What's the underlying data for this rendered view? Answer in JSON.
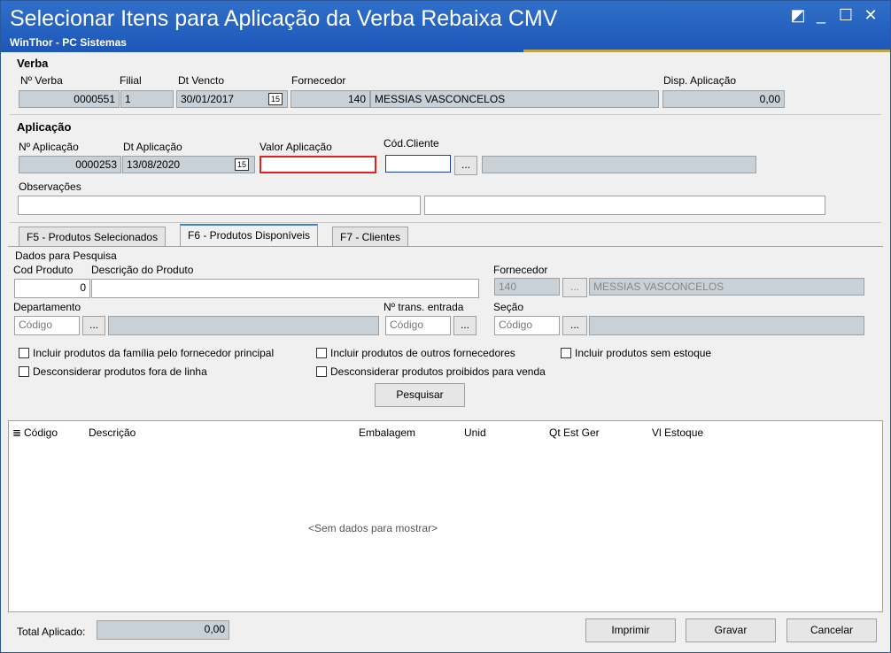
{
  "window": {
    "title": "Selecionar Itens para Aplicação da Verba Rebaixa CMV",
    "subtitle": "WinThor - PC Sistemas",
    "controls": {
      "restore": "◩",
      "minimize": "_",
      "maximize": "☐",
      "close": "✕"
    }
  },
  "verba": {
    "section": "Verba",
    "labels": {
      "numero": "Nº Verba",
      "filial": "Filial",
      "dt_vencto": "Dt Vencto",
      "fornecedor": "Fornecedor",
      "disp": "Disp. Aplicação"
    },
    "values": {
      "numero": "0000551",
      "filial": "1",
      "dt_vencto": "30/01/2017",
      "fornecedor_cod": "140",
      "fornecedor_nome": "MESSIAS VASCONCELOS",
      "disp": "0,00"
    }
  },
  "aplicacao": {
    "section": "Aplicação",
    "labels": {
      "numero": "Nº Aplicação",
      "dt": "Dt Aplicação",
      "valor": "Valor Aplicação",
      "cod_cliente": "Cód.Cliente",
      "obs": "Observações"
    },
    "values": {
      "numero": "0000253",
      "dt": "13/08/2020",
      "valor": "",
      "cod_cliente": "",
      "cliente_nome": "",
      "obs1": "",
      "obs2": ""
    }
  },
  "calendar_glyph": "15",
  "ellipsis": "...",
  "tabs": [
    {
      "label": "F5 - Produtos Selecionados",
      "active": false
    },
    {
      "label": "F6 - Produtos Disponíveis",
      "active": true
    },
    {
      "label": "F7 - Clientes",
      "active": false
    }
  ],
  "pesquisa": {
    "section": "Dados para Pesquisa",
    "labels": {
      "cod_produto": "Cod Produto",
      "descricao": "Descrição do Produto",
      "fornecedor": "Fornecedor",
      "departamento": "Departamento",
      "trans": "Nº trans. entrada",
      "secao": "Seção"
    },
    "values": {
      "cod_produto": "0",
      "descricao": "",
      "fornecedor_cod": "140",
      "fornecedor_nome": "MESSIAS VASCONCELOS"
    },
    "placeholders": {
      "departamento": "Código",
      "trans": "Código",
      "secao": "Código"
    },
    "checkboxes": [
      "Incluir produtos da família pelo fornecedor principal",
      "Incluir produtos de outros fornecedores",
      "Incluir produtos sem estoque",
      "Desconsiderar produtos fora de linha",
      "Desconsiderar produtos proibidos para venda"
    ],
    "search_button": "Pesquisar"
  },
  "grid": {
    "columns": [
      "Código",
      "Descrição",
      "Embalagem",
      "Unid",
      "Qt Est Ger",
      "Vl Estoque"
    ],
    "empty_text": "<Sem dados para mostrar>",
    "menu_icon": "≣"
  },
  "footer": {
    "total_label": "Total Aplicado:",
    "total_value": "0,00",
    "buttons": {
      "imprimir": "Imprimir",
      "gravar": "Gravar",
      "cancelar": "Cancelar"
    }
  }
}
